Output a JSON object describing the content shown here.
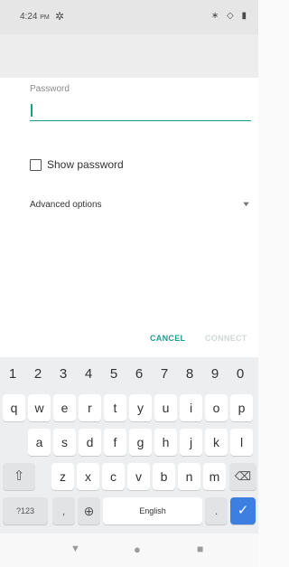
{
  "status_bar": {
    "time": "4:24",
    "ampm": "PM",
    "gear_icon": "gear-icon",
    "icons": [
      "bluetooth-icon",
      "data-icon",
      "battery-icon"
    ],
    "icons_text": "∗ ◇ ▮"
  },
  "form": {
    "password_label": "Password",
    "password_value": "",
    "show_password_label": "Show password",
    "advanced_options_label": "Advanced options"
  },
  "actions": {
    "cancel": "CANCEL",
    "connect": "CONNECT"
  },
  "keyboard": {
    "number_row": [
      "1",
      "2",
      "3",
      "4",
      "5",
      "6",
      "7",
      "8",
      "9",
      "0"
    ],
    "row1": [
      "q",
      "w",
      "e",
      "r",
      "t",
      "y",
      "u",
      "i",
      "o",
      "p"
    ],
    "row2": [
      "a",
      "s",
      "d",
      "f",
      "g",
      "h",
      "j",
      "k",
      "l"
    ],
    "row3": [
      "z",
      "x",
      "c",
      "v",
      "b",
      "n",
      "m"
    ],
    "symbols_key": "?123",
    "comma_key": ",",
    "space_label": "English",
    "period_key": ".",
    "enter_key": "✓",
    "shift_glyph": "⇧",
    "backspace_glyph": "⌫",
    "globe_glyph": "⊕"
  },
  "nav_bar": {
    "back": "▼",
    "home": "●",
    "recents": "■"
  },
  "colors": {
    "accent": "#1e9c8a",
    "enter_key": "#3d7fe0"
  }
}
